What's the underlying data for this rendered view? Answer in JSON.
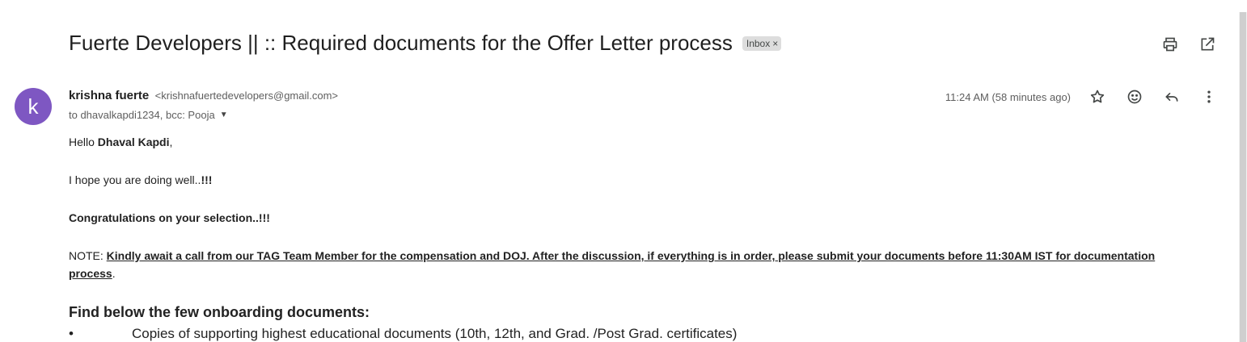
{
  "email": {
    "subject": "Fuerte Developers || :: Required documents for the Offer Letter process",
    "label": "Inbox",
    "label_close": "×",
    "sender": {
      "avatar_letter": "k",
      "name": "krishna fuerte",
      "email": "<krishnafuertedevelopers@gmail.com>"
    },
    "recipients": "to dhavalkapdi1234, bcc: Pooja",
    "timestamp": "11:24 AM (58 minutes ago)",
    "actions": {
      "top": [
        "print-icon",
        "open-in-new-window-icon"
      ],
      "message": [
        "star-icon",
        "emoji-reaction-icon",
        "reply-icon",
        "more-options-icon"
      ]
    },
    "body": {
      "greeting_prefix": "Hello ",
      "greeting_name": "Dhaval Kapdi",
      "greeting_suffix": ",",
      "hope_text": "I hope you are doing well..",
      "hope_bold": "!!!",
      "congrats": "Congratulations on your selection..!!!",
      "note_prefix": "NOTE: ",
      "note_text": "Kindly await a call from our TAG Team Member for the compensation and DOJ. After the discussion, if everything is in order, please submit your documents before 11:30AM IST for documentation process",
      "note_suffix": ".",
      "heading": "Find below the few onboarding documents:",
      "bullets": [
        {
          "marker": "•",
          "text": "Copies of supporting highest educational documents (10th, 12th, and Grad. /Post Grad. certificates)"
        }
      ]
    }
  },
  "colors": {
    "avatar_bg": "#7e57c2",
    "label_chip_bg": "#dddddd",
    "text_secondary": "#5e5e5e"
  }
}
